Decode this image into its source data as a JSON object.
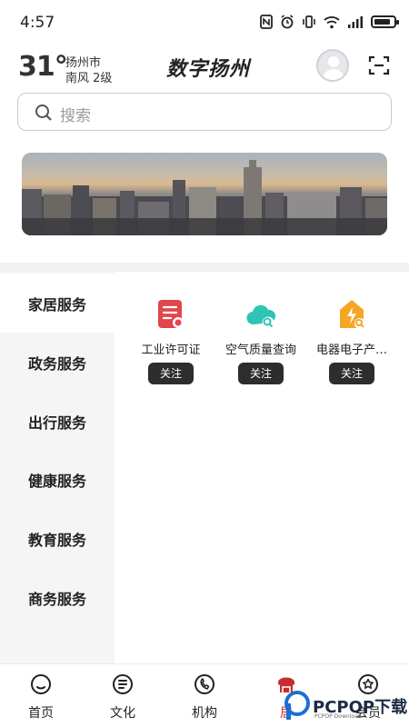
{
  "status_bar": {
    "time": "4:57",
    "icons": [
      "nfc-icon",
      "alarm-icon",
      "vibrate-icon",
      "wifi-icon",
      "signal-icon",
      "battery-icon"
    ],
    "battery_level": 0.85
  },
  "header": {
    "temperature": "31°",
    "city": "扬州市",
    "wind": "南风  2级",
    "brand_title": "数字扬州"
  },
  "search": {
    "placeholder": "搜索"
  },
  "categories": [
    {
      "label": "家居服务",
      "active": true
    },
    {
      "label": "政务服务",
      "active": false
    },
    {
      "label": "出行服务",
      "active": false
    },
    {
      "label": "健康服务",
      "active": false
    },
    {
      "label": "教育服务",
      "active": false
    },
    {
      "label": "商务服务",
      "active": false
    }
  ],
  "services": [
    {
      "name": "工业许可证",
      "button": "关注",
      "icon": "certificate-icon",
      "color": "#e0474c"
    },
    {
      "name": "空气质量查询",
      "button": "关注",
      "icon": "cloud-search-icon",
      "color": "#2ec4b6"
    },
    {
      "name": "电器电子产…",
      "button": "关注",
      "icon": "power-search-icon",
      "color": "#f5a623"
    }
  ],
  "bottom_nav": [
    {
      "label": "首页",
      "icon": "home-icon",
      "active": false
    },
    {
      "label": "文化",
      "icon": "culture-icon",
      "active": false
    },
    {
      "label": "机构",
      "icon": "organization-icon",
      "active": false
    },
    {
      "label": "居",
      "icon": "living-icon",
      "active": true
    },
    {
      "label": "会员",
      "icon": "member-icon",
      "active": false
    }
  ],
  "watermark": {
    "brand": "PCPOP下载",
    "sub": "PCPOP Download"
  },
  "colors": {
    "accent": "#c62f2f",
    "button_dark": "#2d2d2d",
    "sidebar_bg": "#f5f5f5"
  }
}
